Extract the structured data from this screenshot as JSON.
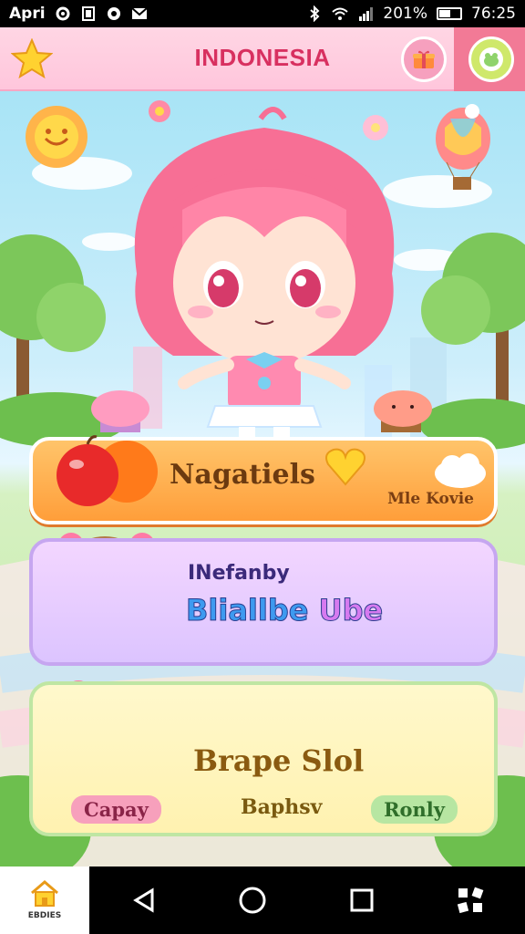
{
  "status_bar": {
    "carrier": "Apri",
    "battery": "201%",
    "time": "76:25"
  },
  "header": {
    "title": "INDONESIA"
  },
  "cards": {
    "card1": {
      "title": "Nagatiels",
      "subtitle": "Mle Kovie"
    },
    "card2": {
      "title_small": "INefanby",
      "title_part1": "Bliallbe",
      "title_part2": "Ube"
    },
    "card3": {
      "title": "Brape Slol",
      "pill_left": "Capay",
      "pill_middle": "Baphsv",
      "pill_right": "Ronly"
    }
  },
  "navbar": {
    "home_label": "EBDIES"
  },
  "colors": {
    "header_bg": "#ffc6dc",
    "title": "#d83060",
    "orange_card": "#ff9e3a",
    "purple_card": "#dcc4ff",
    "yellow_card": "#fff2b0"
  }
}
